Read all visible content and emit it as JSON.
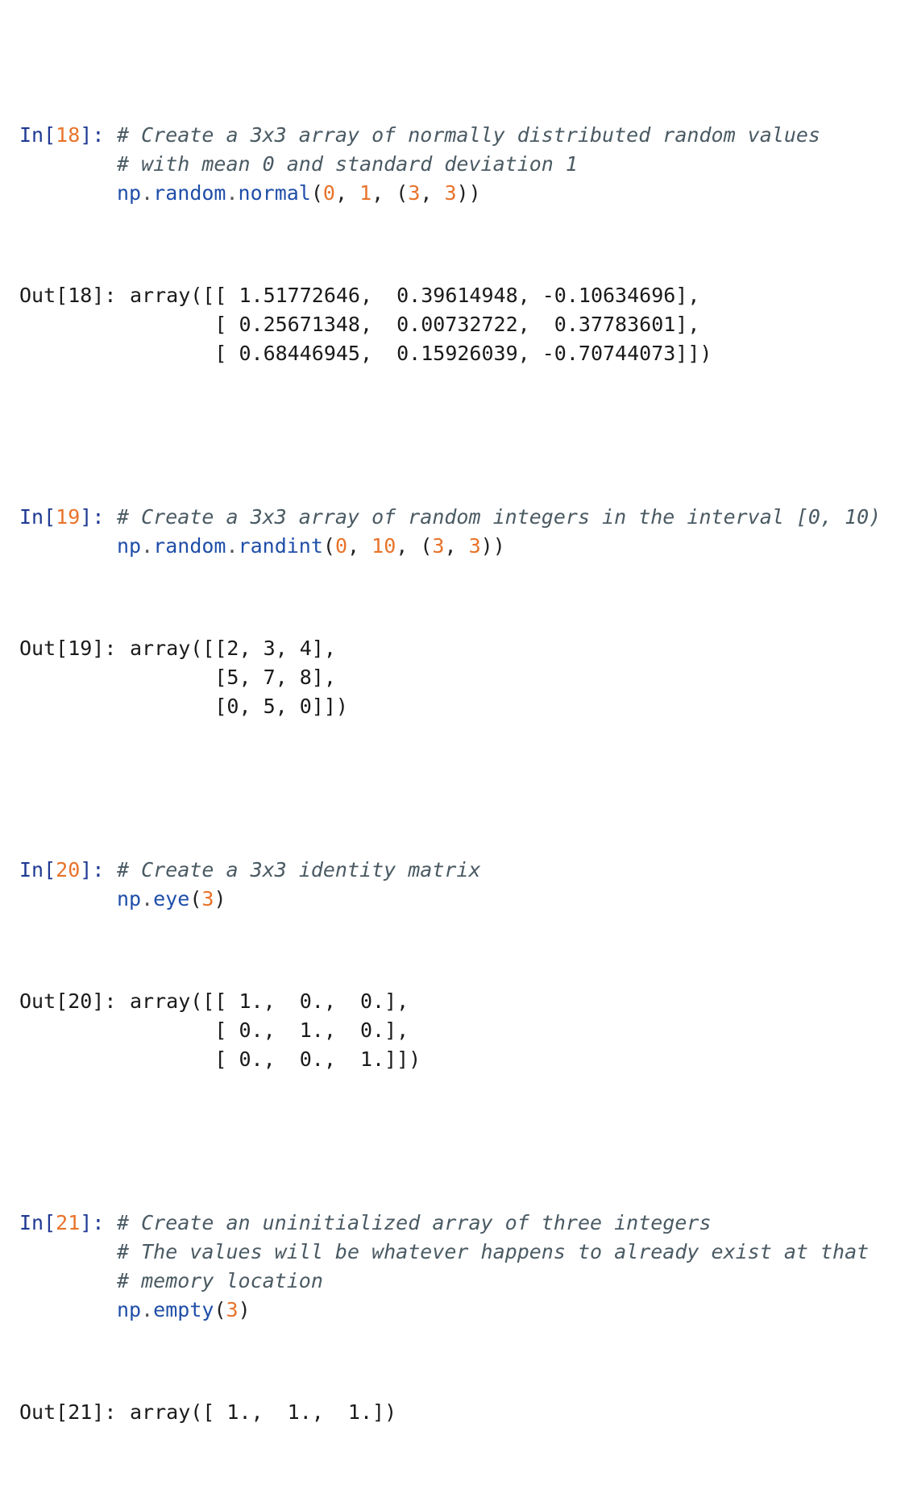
{
  "cells": [
    {
      "in_prompt_label": "In[",
      "in_prompt_number": "18",
      "in_prompt_close": "]:",
      "comments": [
        "# Create a 3x3 array of normally distributed random values",
        "# with mean 0 and standard deviation 1"
      ],
      "code": {
        "module": "np",
        "dot1": ".",
        "submodule": "random",
        "dot2": ".",
        "func": "normal",
        "open": "(",
        "args": [
          "0",
          "1"
        ],
        "tuple": [
          "3",
          "3"
        ],
        "close": ")"
      },
      "out_prompt": "Out[18]:",
      "output_lines": [
        "array([[ 1.51772646,  0.39614948, -0.10634696],",
        "       [ 0.25671348,  0.00732722,  0.37783601],",
        "       [ 0.68446945,  0.15926039, -0.70744073]])"
      ]
    },
    {
      "in_prompt_label": "In[",
      "in_prompt_number": "19",
      "in_prompt_close": "]:",
      "comments": [
        "# Create a 3x3 array of random integers in the interval [0, 10)"
      ],
      "code": {
        "module": "np",
        "dot1": ".",
        "submodule": "random",
        "dot2": ".",
        "func": "randint",
        "open": "(",
        "args": [
          "0",
          "10"
        ],
        "tuple": [
          "3",
          "3"
        ],
        "close": ")"
      },
      "out_prompt": "Out[19]:",
      "output_lines": [
        "array([[2, 3, 4],",
        "       [5, 7, 8],",
        "       [0, 5, 0]])"
      ]
    },
    {
      "in_prompt_label": "In[",
      "in_prompt_number": "20",
      "in_prompt_close": "]:",
      "comments": [
        "# Create a 3x3 identity matrix"
      ],
      "code": {
        "module": "np",
        "dot1": ".",
        "func": "eye",
        "open": "(",
        "single_arg": "3",
        "close": ")"
      },
      "out_prompt": "Out[20]:",
      "output_lines": [
        "array([[ 1.,  0.,  0.],",
        "       [ 0.,  1.,  0.],",
        "       [ 0.,  0.,  1.]])"
      ]
    },
    {
      "in_prompt_label": "In[",
      "in_prompt_number": "21",
      "in_prompt_close": "]:",
      "comments": [
        "# Create an uninitialized array of three integers",
        "# The values will be whatever happens to already exist at that",
        "# memory location"
      ],
      "code": {
        "module": "np",
        "dot1": ".",
        "func": "empty",
        "open": "(",
        "single_arg": "3",
        "close": ")"
      },
      "out_prompt": "Out[21]:",
      "output_lines": [
        "array([ 1.,  1.,  1.])"
      ]
    }
  ],
  "colors": {
    "prompt_in": "#1f3a93",
    "number_literal": "#e8732a",
    "comment": "#4a5a63",
    "function": "#1f4ea8"
  }
}
